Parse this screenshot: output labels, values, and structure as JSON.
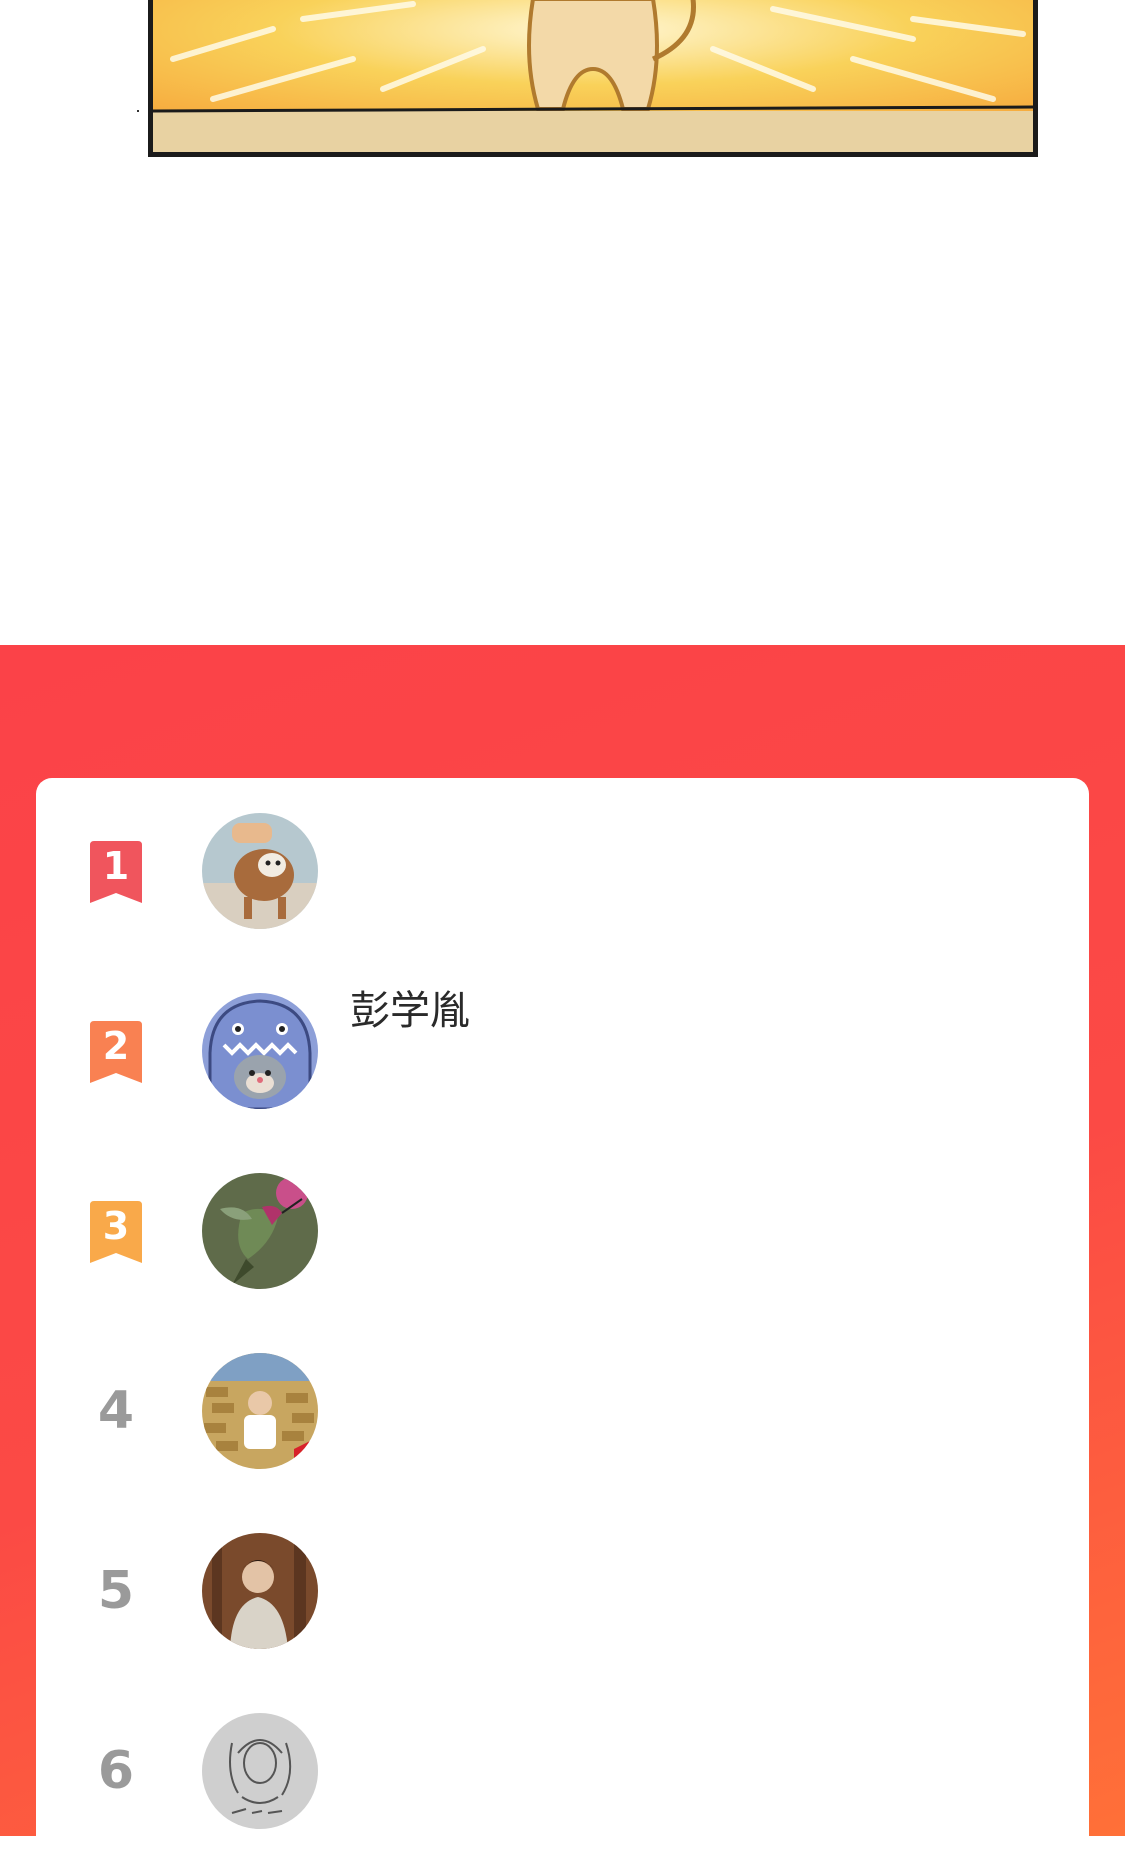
{
  "ranking": {
    "entries": [
      {
        "rank": "1",
        "name": "",
        "badge_color": "#f0555d",
        "avatar": "dog-photo-avatar"
      },
      {
        "rank": "2",
        "name": "彭学胤",
        "badge_color": "#f98152",
        "avatar": "cartoon-cat-in-dino-hood-avatar"
      },
      {
        "rank": "3",
        "name": "",
        "badge_color": "#f9a94a",
        "avatar": "hummingbird-avatar"
      },
      {
        "rank": "4",
        "name": "",
        "avatar": "person-with-money-avatar"
      },
      {
        "rank": "5",
        "name": "",
        "avatar": "portrait-photo-avatar"
      },
      {
        "rank": "6",
        "name": "",
        "avatar": "sketch-drawing-avatar"
      }
    ]
  },
  "colors": {
    "section_top": "#fb4248",
    "section_bottom": "#ff7038",
    "card_background": "#ffffff",
    "rank_number_gray": "#9a9a9a"
  }
}
